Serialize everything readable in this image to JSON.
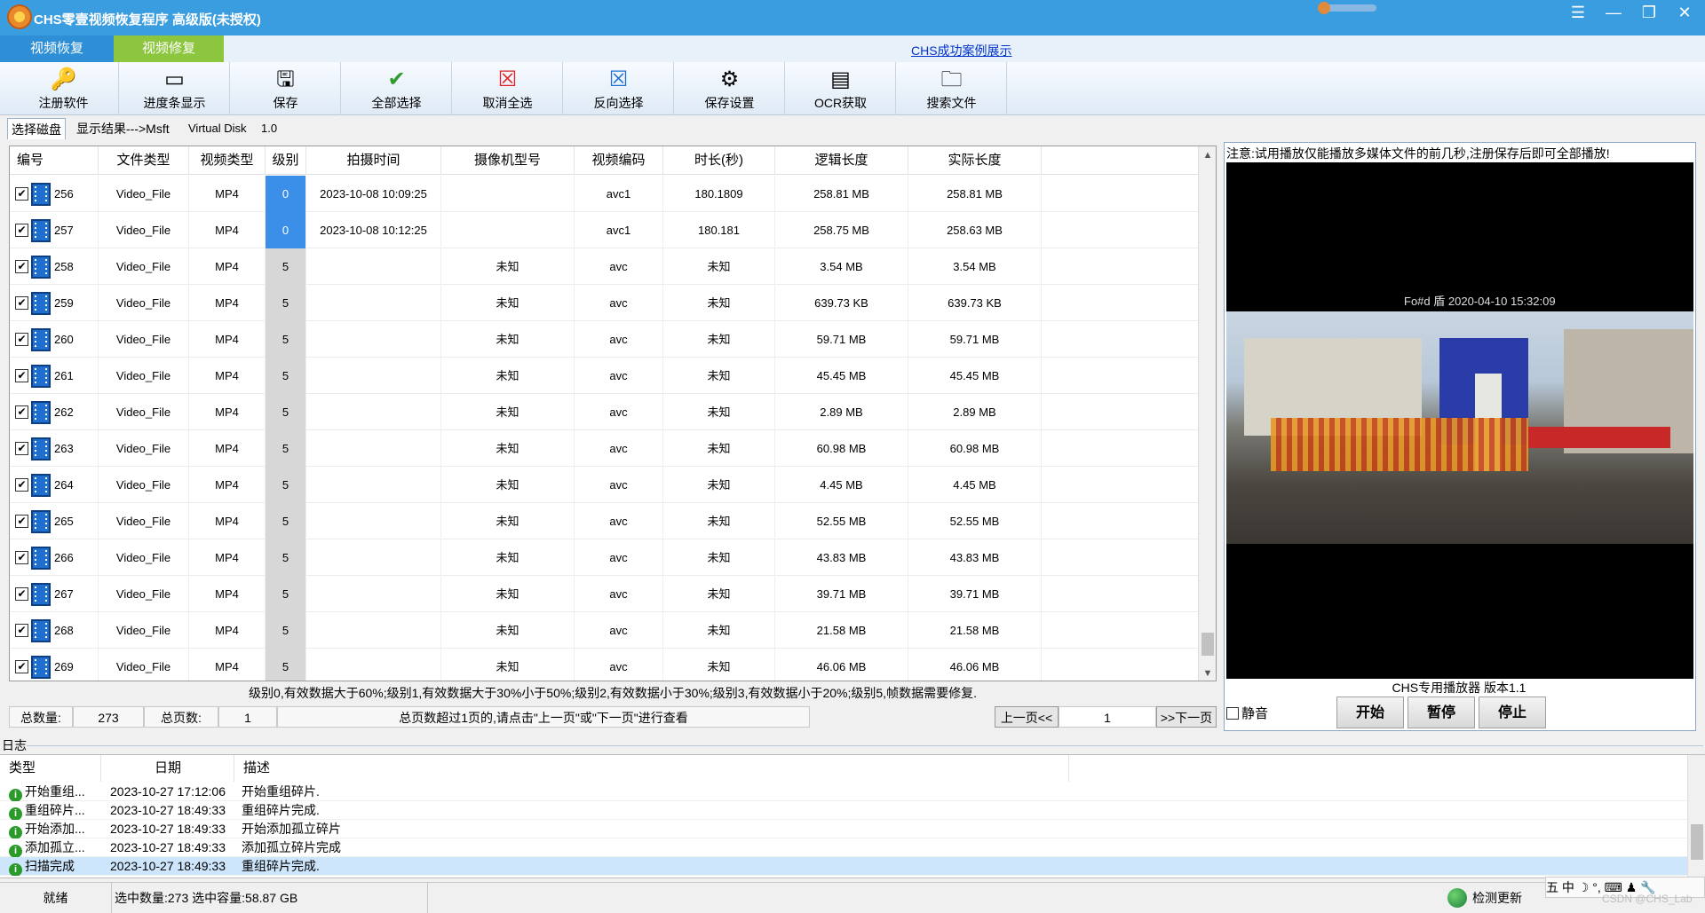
{
  "window": {
    "title": "CHS零壹视频恢复程序 高级版(未授权)",
    "controls": [
      "☰",
      "—",
      "❐",
      "✕"
    ]
  },
  "tabs": {
    "recover": "视频恢复",
    "repair": "视频修复",
    "cases_link": "CHS成功案例展示"
  },
  "toolbar": [
    {
      "label": "注册软件",
      "icon": "key-icon",
      "glyph": "🔑"
    },
    {
      "label": "进度条显示",
      "icon": "progress-icon",
      "glyph": "▭"
    },
    {
      "label": "保存",
      "icon": "save-icon",
      "glyph": "🖫"
    },
    {
      "label": "全部选择",
      "icon": "checkmark-icon",
      "glyph": "✔",
      "color": "#2e9b2e"
    },
    {
      "label": "取消全选",
      "icon": "cancel-select-icon",
      "glyph": "☒",
      "color": "#e02020"
    },
    {
      "label": "反向选择",
      "icon": "invert-select-icon",
      "glyph": "☒",
      "color": "#1e6fd0"
    },
    {
      "label": "保存设置",
      "icon": "settings-icon",
      "glyph": "⚙"
    },
    {
      "label": "OCR获取",
      "icon": "ocr-icon",
      "glyph": "▤"
    },
    {
      "label": "搜索文件",
      "icon": "search-folder-icon",
      "glyph": "🗀"
    }
  ],
  "disk_tabs": {
    "select_disk": "选择磁盘",
    "result": "显示结果--->Msft",
    "disk": "Virtual Disk",
    "version": "1.0"
  },
  "table": {
    "headers": [
      "编号",
      "文件类型",
      "视频类型",
      "级别",
      "拍摄时间",
      "摄像机型号",
      "视频编码",
      "时长(秒)",
      "逻辑长度",
      "实际长度"
    ],
    "rows": [
      {
        "id": "256",
        "file_type": "Video_File",
        "video_type": "MP4",
        "level": "0",
        "time": "2023-10-08 10:09:25",
        "camera": "",
        "codec": "avc1",
        "duration": "180.1809",
        "logical": "258.81 MB",
        "actual": "258.81 MB"
      },
      {
        "id": "257",
        "file_type": "Video_File",
        "video_type": "MP4",
        "level": "0",
        "time": "2023-10-08 10:12:25",
        "camera": "",
        "codec": "avc1",
        "duration": "180.181",
        "logical": "258.75 MB",
        "actual": "258.63 MB"
      },
      {
        "id": "258",
        "file_type": "Video_File",
        "video_type": "MP4",
        "level": "5",
        "time": "",
        "camera": "未知",
        "codec": "avc",
        "duration": "未知",
        "logical": "3.54 MB",
        "actual": "3.54 MB"
      },
      {
        "id": "259",
        "file_type": "Video_File",
        "video_type": "MP4",
        "level": "5",
        "time": "",
        "camera": "未知",
        "codec": "avc",
        "duration": "未知",
        "logical": "639.73 KB",
        "actual": "639.73 KB"
      },
      {
        "id": "260",
        "file_type": "Video_File",
        "video_type": "MP4",
        "level": "5",
        "time": "",
        "camera": "未知",
        "codec": "avc",
        "duration": "未知",
        "logical": "59.71 MB",
        "actual": "59.71 MB"
      },
      {
        "id": "261",
        "file_type": "Video_File",
        "video_type": "MP4",
        "level": "5",
        "time": "",
        "camera": "未知",
        "codec": "avc",
        "duration": "未知",
        "logical": "45.45 MB",
        "actual": "45.45 MB"
      },
      {
        "id": "262",
        "file_type": "Video_File",
        "video_type": "MP4",
        "level": "5",
        "time": "",
        "camera": "未知",
        "codec": "avc",
        "duration": "未知",
        "logical": "2.89 MB",
        "actual": "2.89 MB"
      },
      {
        "id": "263",
        "file_type": "Video_File",
        "video_type": "MP4",
        "level": "5",
        "time": "",
        "camera": "未知",
        "codec": "avc",
        "duration": "未知",
        "logical": "60.98 MB",
        "actual": "60.98 MB"
      },
      {
        "id": "264",
        "file_type": "Video_File",
        "video_type": "MP4",
        "level": "5",
        "time": "",
        "camera": "未知",
        "codec": "avc",
        "duration": "未知",
        "logical": "4.45 MB",
        "actual": "4.45 MB"
      },
      {
        "id": "265",
        "file_type": "Video_File",
        "video_type": "MP4",
        "level": "5",
        "time": "",
        "camera": "未知",
        "codec": "avc",
        "duration": "未知",
        "logical": "52.55 MB",
        "actual": "52.55 MB"
      },
      {
        "id": "266",
        "file_type": "Video_File",
        "video_type": "MP4",
        "level": "5",
        "time": "",
        "camera": "未知",
        "codec": "avc",
        "duration": "未知",
        "logical": "43.83 MB",
        "actual": "43.83 MB"
      },
      {
        "id": "267",
        "file_type": "Video_File",
        "video_type": "MP4",
        "level": "5",
        "time": "",
        "camera": "未知",
        "codec": "avc",
        "duration": "未知",
        "logical": "39.71 MB",
        "actual": "39.71 MB"
      },
      {
        "id": "268",
        "file_type": "Video_File",
        "video_type": "MP4",
        "level": "5",
        "time": "",
        "camera": "未知",
        "codec": "avc",
        "duration": "未知",
        "logical": "21.58 MB",
        "actual": "21.58 MB"
      },
      {
        "id": "269",
        "file_type": "Video_File",
        "video_type": "MP4",
        "level": "5",
        "time": "",
        "camera": "未知",
        "codec": "avc",
        "duration": "未知",
        "logical": "46.06 MB",
        "actual": "46.06 MB"
      }
    ],
    "legend": "级别0,有效数据大于60%;级别1,有效数据大于30%小于50%;级别2,有效数据小于30%;级别3,有效数据小于20%;级别5,帧数据需要修复."
  },
  "pager": {
    "total_label": "总数量:",
    "total_value": "273",
    "pages_label": "总页数:",
    "pages_value": "1",
    "hint": "总页数超过1页的,请点击\"上一页\"或\"下一页\"进行查看",
    "prev": "上一页<<",
    "current": "1",
    "next": ">>下一页"
  },
  "player": {
    "note": "注意:试用播放仅能播放多媒体文件的前几秒,注册保存后即可全部播放!",
    "osd": "2020-04-10 15:32:09",
    "osd_prefix": "Fo#d 盾",
    "version": "CHS专用播放器 版本1.1",
    "mute": "静音",
    "start": "开始",
    "pause": "暂停",
    "stop": "停止"
  },
  "log": {
    "title": "日志",
    "headers": [
      "类型",
      "日期",
      "描述"
    ],
    "rows": [
      {
        "type": "开始重组...",
        "date": "2023-10-27 17:12:06",
        "desc": "开始重组碎片."
      },
      {
        "type": "重组碎片...",
        "date": "2023-10-27 18:49:33",
        "desc": "重组碎片完成."
      },
      {
        "type": "开始添加...",
        "date": "2023-10-27 18:49:33",
        "desc": "开始添加孤立碎片"
      },
      {
        "type": "添加孤立...",
        "date": "2023-10-27 18:49:33",
        "desc": "添加孤立碎片完成"
      },
      {
        "type": "扫描完成",
        "date": "2023-10-27 18:49:33",
        "desc": "重组碎片完成."
      }
    ]
  },
  "status": {
    "ready": "就绪",
    "selected": "选中数量:273 选中容量:58.87 GB",
    "update": "检测更新",
    "ime": "五 中 ☽ °, ⌨ ♟ 🔧",
    "watermark": "CSDN @CHS_Lab"
  },
  "colors": {
    "titlebar": "#3a9de0",
    "tab_recover": "#2e8fd6",
    "tab_repair": "#8cc63f",
    "level_good": "#3b8fe8",
    "level_bad": "#d7d7d7"
  }
}
